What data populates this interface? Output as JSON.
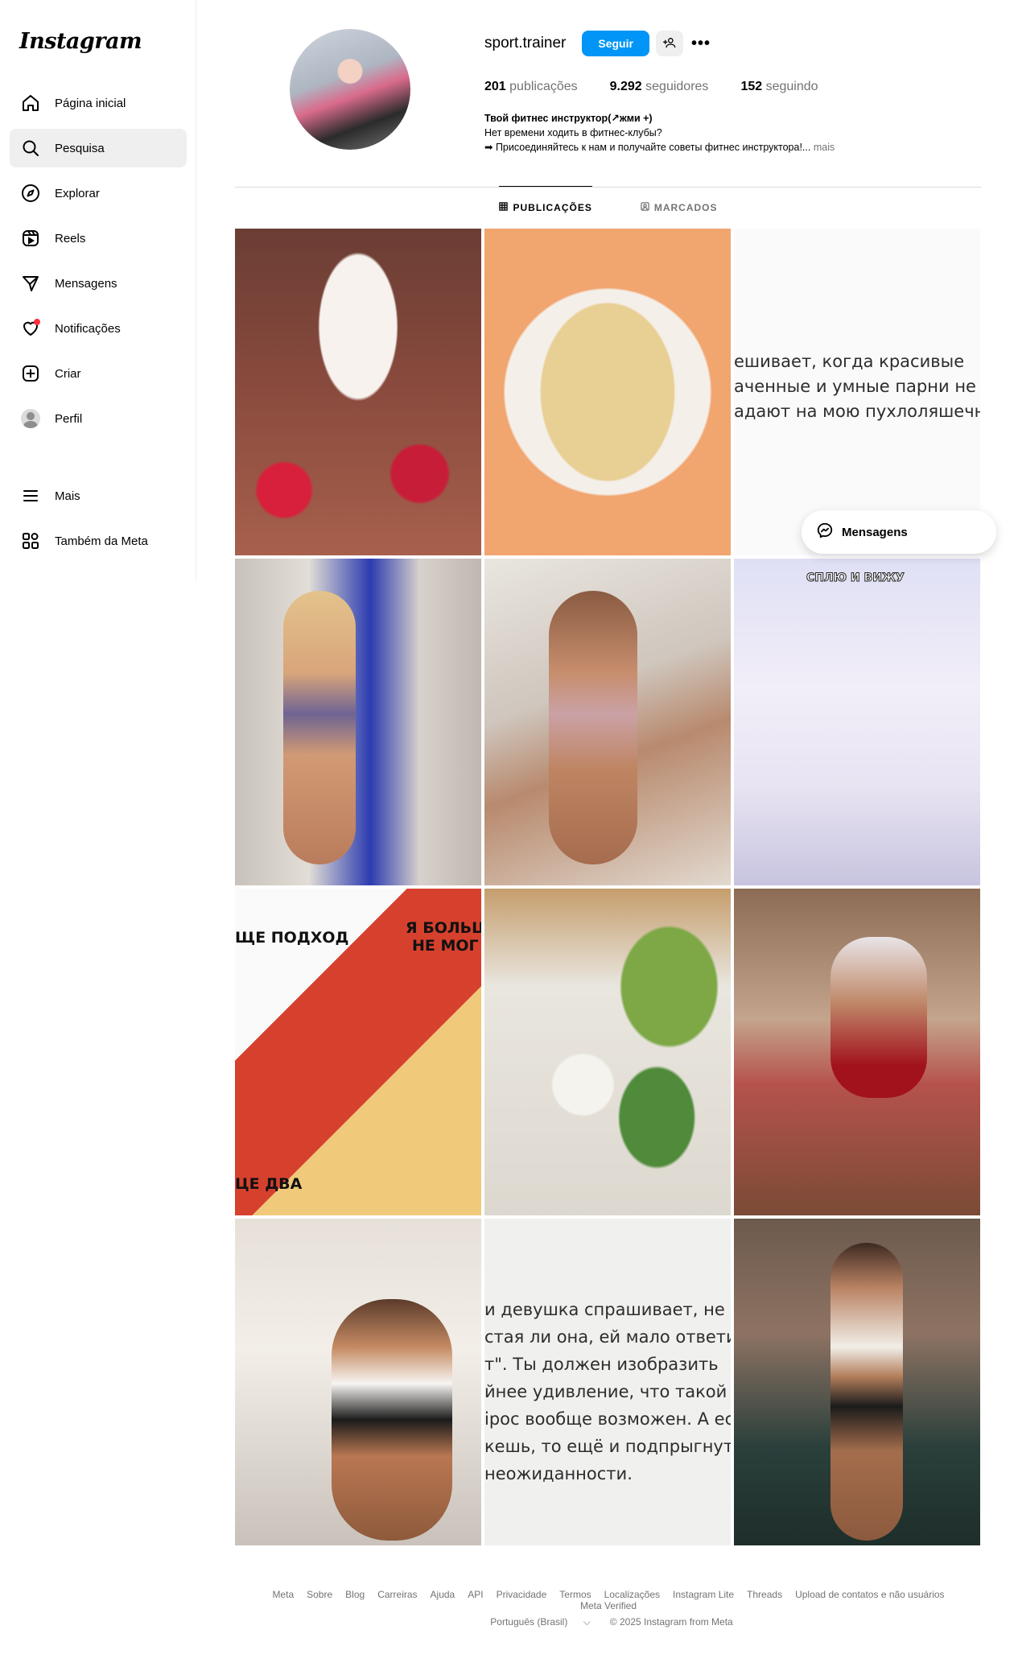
{
  "app": {
    "logo": "Instagram"
  },
  "sidebar": {
    "items": [
      {
        "label": "Página inicial",
        "icon": "home-icon"
      },
      {
        "label": "Pesquisa",
        "icon": "search-icon",
        "active": true
      },
      {
        "label": "Explorar",
        "icon": "compass-icon"
      },
      {
        "label": "Reels",
        "icon": "reels-icon"
      },
      {
        "label": "Mensagens",
        "icon": "send-icon"
      },
      {
        "label": "Notificações",
        "icon": "heart-icon"
      },
      {
        "label": "Criar",
        "icon": "plus-square-icon"
      },
      {
        "label": "Perfil",
        "icon": "avatar"
      }
    ],
    "bottom": [
      {
        "label": "Mais",
        "icon": "menu-icon"
      },
      {
        "label": "Também da Meta",
        "icon": "meta-apps-icon"
      }
    ]
  },
  "profile": {
    "username": "sport.trainer",
    "follow_label": "Seguir",
    "stats": {
      "posts_count": "201",
      "posts_label": "publicações",
      "followers_count": "9.292",
      "followers_label": "seguidores",
      "following_count": "152",
      "following_label": "seguindo"
    },
    "bio": {
      "name": "Твой фитнес инструктор(↗жми +)",
      "line1": "Нет времени ходить в фитнес-клубы?",
      "line2": "➡ Присоединяйтесь к нам и получайте советы фитнес инструктора!...",
      "more": "mais"
    }
  },
  "tabs": [
    {
      "label": "PUBLICAÇÕES",
      "icon": "grid-icon",
      "active": true
    },
    {
      "label": "MARCADOS",
      "icon": "tag-icon"
    }
  ],
  "posts": {
    "p3_text": [
      "ешивает, когда красивые",
      "аченные и умные парни не",
      "адают на мою пухлоляшечно"
    ],
    "p6_title": "СПЛЮ И ВИЖУ",
    "p7_text1": "ЩЕ ПОДХОД",
    "p7_text2a": "Я БОЛЬШ",
    "p7_text2b": "НЕ МОГ",
    "p7_text3": "ЦЕ ДВА",
    "p11_text": [
      "и девушка спрашивает, не",
      "стая ли она, ей мало ответи",
      "т\". Ты должен изобразить",
      "йнее удивление, что такой",
      "ipoc вообще возможен. А есл",
      "кешь, то ещё и подпрыгнуть",
      "неожиданности."
    ]
  },
  "messages_float": {
    "label": "Mensagens"
  },
  "footer": {
    "links": [
      "Meta",
      "Sobre",
      "Blog",
      "Carreiras",
      "Ajuda",
      "API",
      "Privacidade",
      "Termos",
      "Localizações",
      "Instagram Lite",
      "Threads",
      "Upload de contatos e não usuários",
      "Meta Verified"
    ],
    "language": "Português (Brasil)",
    "copyright": "© 2025 Instagram from Meta"
  },
  "colors": {
    "primary_button": "#0095f6",
    "notification_dot": "#ff3040",
    "active_nav_bg": "#efefef"
  }
}
